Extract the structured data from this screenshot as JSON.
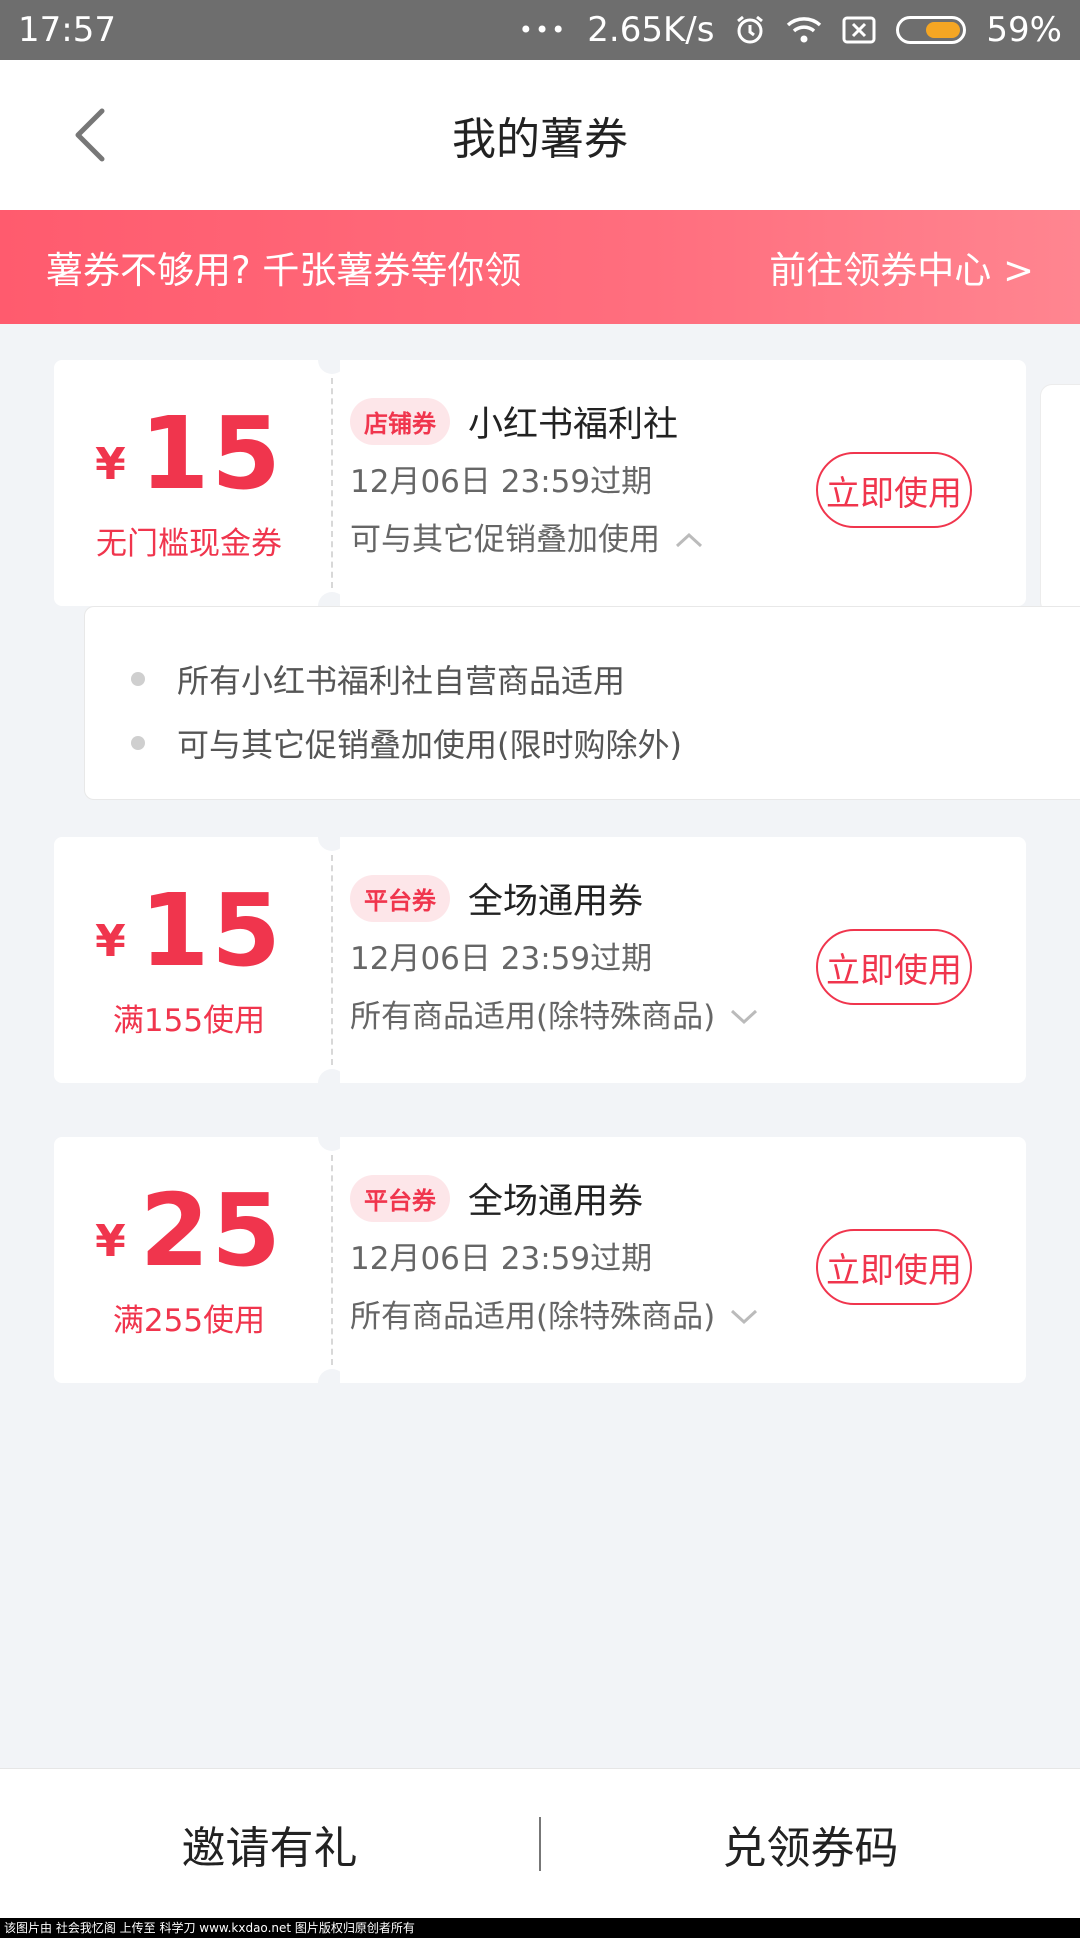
{
  "status_bar": {
    "time": "17:57",
    "dots": "•••",
    "net_speed": "2.65K/s",
    "battery": "59%",
    "icons": [
      "alarm-icon",
      "wifi-icon",
      "sim-off-icon",
      "battery-icon"
    ],
    "battery_level": 0.59
  },
  "header": {
    "title": "我的薯券",
    "back_icon": "chevron-left-icon"
  },
  "banner": {
    "text": "薯券不够用? 千张薯券等你领",
    "link": "前往领券中心 >"
  },
  "coupons": [
    {
      "currency": "¥",
      "amount": "15",
      "condition": "无门槛现金券",
      "tag": "店铺券",
      "name": "小红书福利社",
      "expire": "12月06日 23:59过期",
      "desc": "可与其它促销叠加使用",
      "button": "立即使用",
      "expanded": true
    },
    {
      "currency": "¥",
      "amount": "15",
      "condition": "满155使用",
      "tag": "平台券",
      "name": "全场通用券",
      "expire": "12月06日 23:59过期",
      "desc": "所有商品适用(除特殊商品)",
      "button": "立即使用",
      "expanded": false
    },
    {
      "currency": "¥",
      "amount": "25",
      "condition": "满255使用",
      "tag": "平台券",
      "name": "全场通用券",
      "expire": "12月06日 23:59过期",
      "desc": "所有商品适用(除特殊商品)",
      "button": "立即使用",
      "expanded": false
    }
  ],
  "details": [
    "所有小红书福利社自营商品适用",
    "可与其它促销叠加使用(限时购除外)"
  ],
  "bottom_bar": {
    "invite": "邀请有礼",
    "redeem": "兑领券码"
  },
  "watermark": "该图片由 社会我忆阁 上传至 科学刀 www.kxdao.net 图片版权归原创者所有",
  "colors": {
    "accent": "#f0354d",
    "banner_start": "#ff5b6e",
    "banner_end": "#ff8590",
    "page_bg": "#f2f4f7",
    "status_bar": "#6e6e6e",
    "battery": "#f5a623"
  }
}
